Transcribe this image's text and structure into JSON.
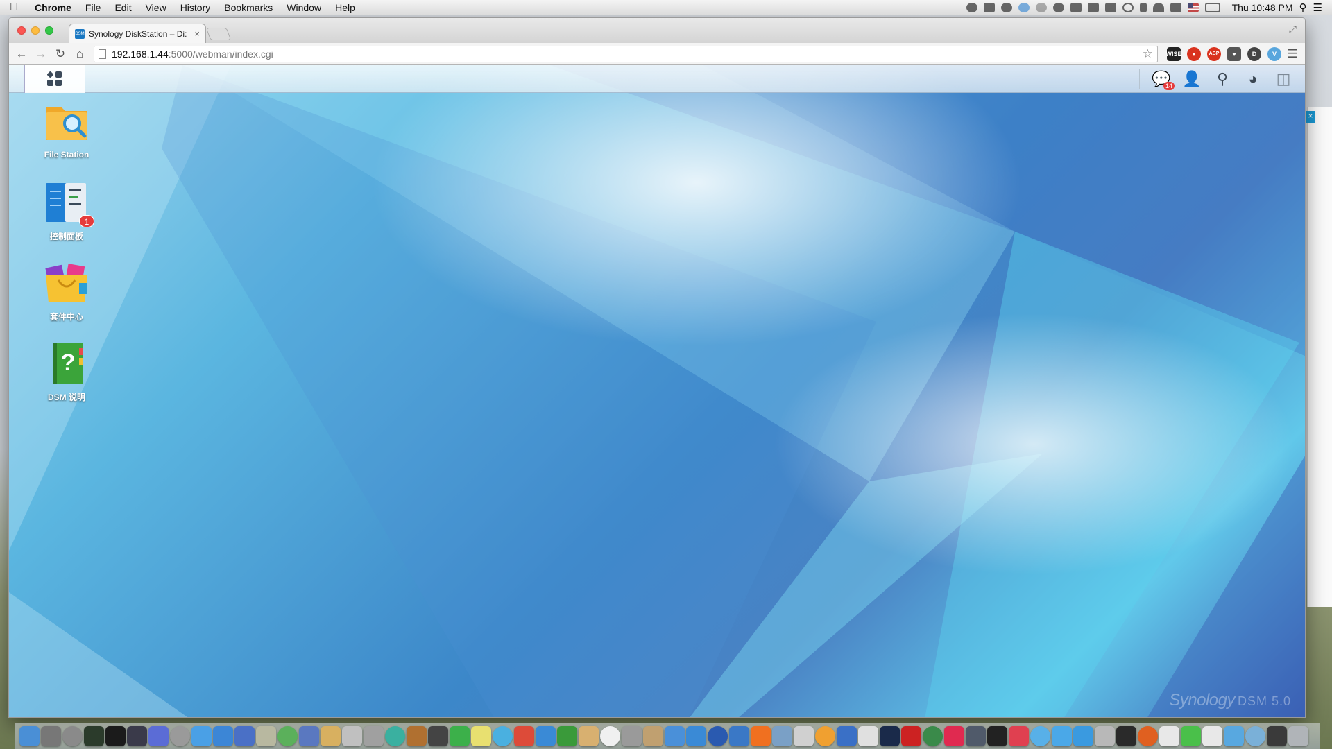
{
  "menubar": {
    "app": "Chrome",
    "items": [
      "File",
      "Edit",
      "View",
      "History",
      "Bookmarks",
      "Window",
      "Help"
    ],
    "clock": "Thu 10:48 PM",
    "status_icons": [
      "wechat-icon",
      "maps-icon",
      "notification-icon",
      "globe-icon",
      "bell-icon",
      "cloud-icon",
      "fb-icon",
      "note-icon",
      "battery-meter-icon",
      "time-machine-icon",
      "bluetooth-icon",
      "wifi-icon",
      "volume-icon",
      "us-flag-icon",
      "battery-icon"
    ]
  },
  "browser": {
    "tab_title": "Synology DiskStation – Di:",
    "favicon_text": "DSM",
    "tab_close": "×",
    "url_host": "192.168.1.44",
    "url_path": ":5000/webman/index.cgi",
    "extensions": [
      {
        "name": "wise-extension-icon",
        "text": "WISE",
        "color": "#222222"
      },
      {
        "name": "record-extension-icon",
        "text": "●",
        "color": "#d9331f"
      },
      {
        "name": "adblock-extension-icon",
        "text": "ABP",
        "color": "#d9331f"
      },
      {
        "name": "pocket-extension-icon",
        "text": "♥",
        "color": "#555555"
      },
      {
        "name": "ghostery-extension-icon",
        "text": "D",
        "color": "#444444"
      },
      {
        "name": "vimeo-extension-icon",
        "text": "V",
        "color": "#58a6dd"
      }
    ]
  },
  "dsm": {
    "tray_badge": "14",
    "desktop_icons": [
      {
        "label": "File Station"
      },
      {
        "label": "控制面板",
        "badge": "1"
      },
      {
        "label": "套件中心"
      },
      {
        "label": "DSM 说明"
      }
    ],
    "watermark_brand": "Synology",
    "watermark_version": "DSM 5.0"
  },
  "dock": {
    "icons": [
      {
        "name": "finder-icon",
        "color": "#4a8fd6"
      },
      {
        "name": "launchpad-icon",
        "color": "#777777"
      },
      {
        "name": "preview-icon",
        "color": "#8a8a8a"
      },
      {
        "name": "activity-monitor-icon",
        "color": "#2b3b2b"
      },
      {
        "name": "terminal-icon",
        "color": "#1b1b1b"
      },
      {
        "name": "magic-icon",
        "color": "#3a3a4a"
      },
      {
        "name": "xcode-icon",
        "color": "#5b6cd6"
      },
      {
        "name": "keyboard-icon",
        "color": "#9a9a9a"
      },
      {
        "name": "mail-icon",
        "color": "#4aa0e6"
      },
      {
        "name": "pages-icon",
        "color": "#3c86d6"
      },
      {
        "name": "numbers-icon",
        "color": "#4a70c6"
      },
      {
        "name": "script-icon",
        "color": "#b8b8a0"
      },
      {
        "name": "sublime-icon",
        "color": "#5bb05b"
      },
      {
        "name": "sequel-icon",
        "color": "#5a78c0"
      },
      {
        "name": "gift-icon",
        "color": "#d8b060"
      },
      {
        "name": "disk-icon",
        "color": "#c0c0c0"
      },
      {
        "name": "scanner-icon",
        "color": "#a0a0a0"
      },
      {
        "name": "mou-icon",
        "color": "#3ab0a0"
      },
      {
        "name": "sequel-pro-icon",
        "color": "#b07030"
      },
      {
        "name": "fb-icon",
        "color": "#444444"
      },
      {
        "name": "evernote-icon",
        "color": "#3cb04a"
      },
      {
        "name": "stickies-icon",
        "color": "#e8e070"
      },
      {
        "name": "safari-icon",
        "color": "#4ab0e0"
      },
      {
        "name": "chrome-icon",
        "color": "#dd4b39"
      },
      {
        "name": "vscode-icon",
        "color": "#3a8ad6"
      },
      {
        "name": "utorrent-icon",
        "color": "#3a9a3a"
      },
      {
        "name": "notes-icon",
        "color": "#d8b070"
      },
      {
        "name": "calendar-icon",
        "color": "#f0f0f0"
      },
      {
        "name": "automator-icon",
        "color": "#9a9a9a"
      },
      {
        "name": "photo-icon",
        "color": "#c0a070"
      },
      {
        "name": "itunes-icon",
        "color": "#4a90d9"
      },
      {
        "name": "appstore-icon",
        "color": "#3a8ad6"
      },
      {
        "name": "quicktime-icon",
        "color": "#2a5ab0"
      },
      {
        "name": "player-icon",
        "color": "#3a78c6"
      },
      {
        "name": "xiami-icon",
        "color": "#f07020"
      },
      {
        "name": "preview2-icon",
        "color": "#7aa0c6"
      },
      {
        "name": "photos-icon",
        "color": "#d0d0d0"
      },
      {
        "name": "book-icon",
        "color": "#f0a030"
      },
      {
        "name": "keynote-icon",
        "color": "#3a70c6"
      },
      {
        "name": "textedit-icon",
        "color": "#e0e0e0"
      },
      {
        "name": "photoshop-icon",
        "color": "#1a2a4a"
      },
      {
        "name": "adobe-icon",
        "color": "#cc2222"
      },
      {
        "name": "excel-icon",
        "color": "#3a8a4a"
      },
      {
        "name": "lips-icon",
        "color": "#e02a50"
      },
      {
        "name": "camera-icon",
        "color": "#505a6a"
      },
      {
        "name": "qq-icon",
        "color": "#222222"
      },
      {
        "name": "sogou-icon",
        "color": "#e04050"
      },
      {
        "name": "messages-icon",
        "color": "#58b0e8"
      },
      {
        "name": "twitter-icon",
        "color": "#4aa8e8"
      },
      {
        "name": "qq2-icon",
        "color": "#3a9ae0"
      },
      {
        "name": "settings-icon",
        "color": "#b8b8b8"
      },
      {
        "name": "kindle-icon",
        "color": "#2a2a2a"
      },
      {
        "name": "firefox-icon",
        "color": "#e06020"
      },
      {
        "name": "grid-app-icon",
        "color": "#e8e8e8"
      },
      {
        "name": "wechat-dock-icon",
        "color": "#4ac04a"
      },
      {
        "name": "document-icon",
        "color": "#e8e8e8"
      },
      {
        "name": "folder-icon",
        "color": "#58a8e0"
      },
      {
        "name": "folder2-icon",
        "color": "#7ab0d8"
      },
      {
        "name": "display-icon",
        "color": "#3a3a3a"
      },
      {
        "name": "trash-icon",
        "color": "#b0b4b8"
      }
    ]
  }
}
